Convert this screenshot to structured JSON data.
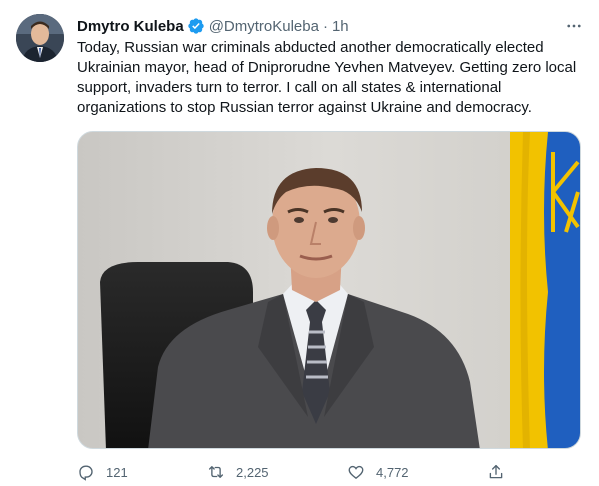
{
  "tweet": {
    "author_name": "Dmytro Kuleba",
    "handle": "@DmytroKuleba",
    "separator": "·",
    "time": "1h",
    "text": "Today, Russian war criminals abducted another democratically elected Ukrainian mayor, head of Dniprorudne Yevhen Matveyev. Getting zero local support, invaders turn to terror. I call on all states & international organizations to stop Russian terror against Ukraine and democracy."
  },
  "actions": {
    "replies": "121",
    "retweets": "2,225",
    "likes": "4,772"
  },
  "icons": {
    "verified": "verified-badge-icon",
    "more": "more-icon",
    "reply": "reply-icon",
    "retweet": "retweet-icon",
    "like": "like-icon",
    "share": "share-icon"
  },
  "colors": {
    "text": "#0f1419",
    "secondary": "#536471",
    "verified": "#1d9bf0",
    "flag_blue": "#1f5fbf",
    "flag_yellow": "#f2c200"
  }
}
